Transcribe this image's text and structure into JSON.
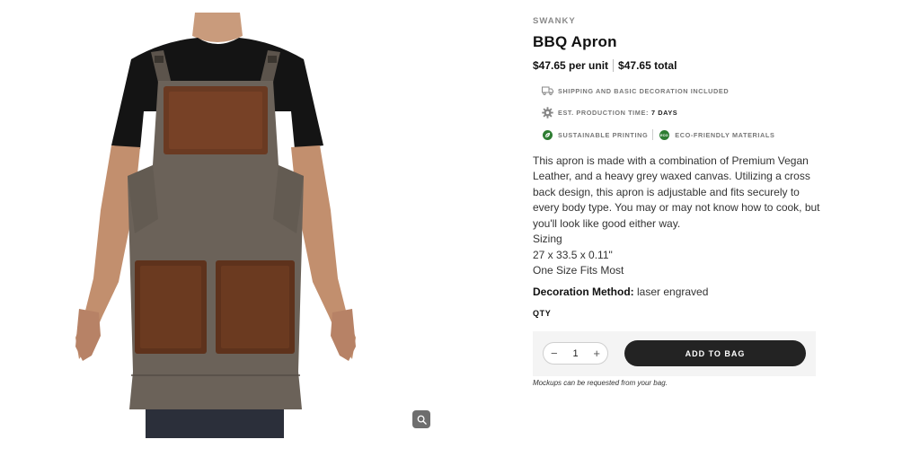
{
  "product": {
    "vendor": "SWANKY",
    "title": "BBQ Apron",
    "price_per_unit": "$47.65 per unit",
    "price_total": "$47.65 total",
    "image_alt": "BBQ Apron",
    "features": {
      "shipping": "SHIPPING AND BASIC DECORATION INCLUDED",
      "production_label": "EST. PRODUCTION TIME:",
      "production_value": "7 DAYS",
      "sustainable": "SUSTAINABLE PRINTING",
      "eco": "ECO-FRIENDLY MATERIALS"
    },
    "description": {
      "paragraph": "This apron is made with a combination of Premium Vegan Leather, and a heavy grey waxed canvas. Utilizing a cross back design, this apron is adjustable and fits securely to every body type. You may or may not know how to cook, but you'll look like good either way.",
      "sizing_label": "Sizing",
      "dimensions": "27 x 33.5 x 0.11\"",
      "fit": "One Size Fits Most"
    },
    "decoration_label": "Decoration Method:",
    "decoration_value": "laser engraved"
  },
  "cart": {
    "qty_label": "QTY",
    "qty_value": "1",
    "minus": "−",
    "plus": "+",
    "add_button": "ADD TO BAG",
    "note": "Mockups can be requested from your bag."
  },
  "icons": {
    "truck": "truck-icon",
    "gear": "gear-icon",
    "leaf": "leaf-icon",
    "eco": "eco-badge-icon",
    "zoom": "zoom-icon"
  },
  "colors": {
    "button": "#232323",
    "eco_green": "#2e7d32",
    "apron_canvas": "#6b6259",
    "leather": "#6a3a22"
  },
  "eco_badge_text": "ECO"
}
